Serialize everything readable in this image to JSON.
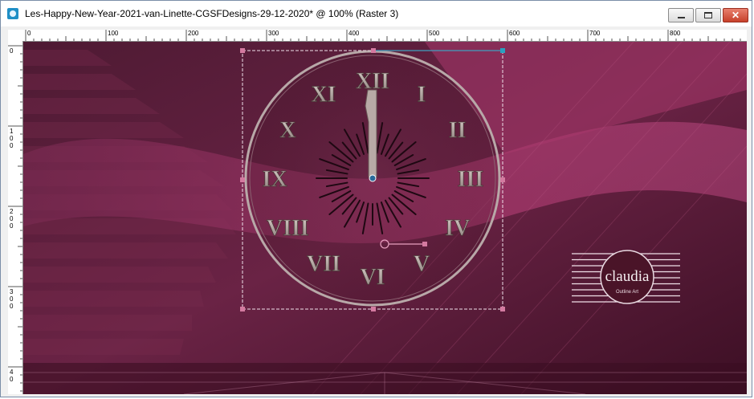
{
  "window": {
    "title": "Les-Happy-New-Year-2021-van-Linette-CGSFDesigns-29-12-2020* @ 100% (Raster 3)"
  },
  "controls": {
    "minimize_icon": "minimize-icon",
    "maximize_icon": "maximize-icon",
    "close_icon": "close-icon",
    "close_glyph": "✕"
  },
  "ruler": {
    "h_labels": [
      "0",
      "100",
      "200",
      "300",
      "400",
      "500",
      "600",
      "700",
      "800"
    ],
    "v_labels": [
      "0",
      "1 0 0",
      "2 0 0",
      "3 0 0",
      "4 0"
    ]
  },
  "artwork": {
    "numerals": [
      "XII",
      "I",
      "II",
      "III",
      "IV",
      "V",
      "VI",
      "VII",
      "VIII",
      "IX",
      "X",
      "XI"
    ],
    "watermark_name": "claudia",
    "watermark_sub": "Outline Art",
    "colors": {
      "background": "#5a1e38",
      "accent": "#c04a84",
      "numeral": "#b0a29e",
      "selection_handle": "#d47aa0",
      "anchor": "#2aa0c0"
    }
  }
}
